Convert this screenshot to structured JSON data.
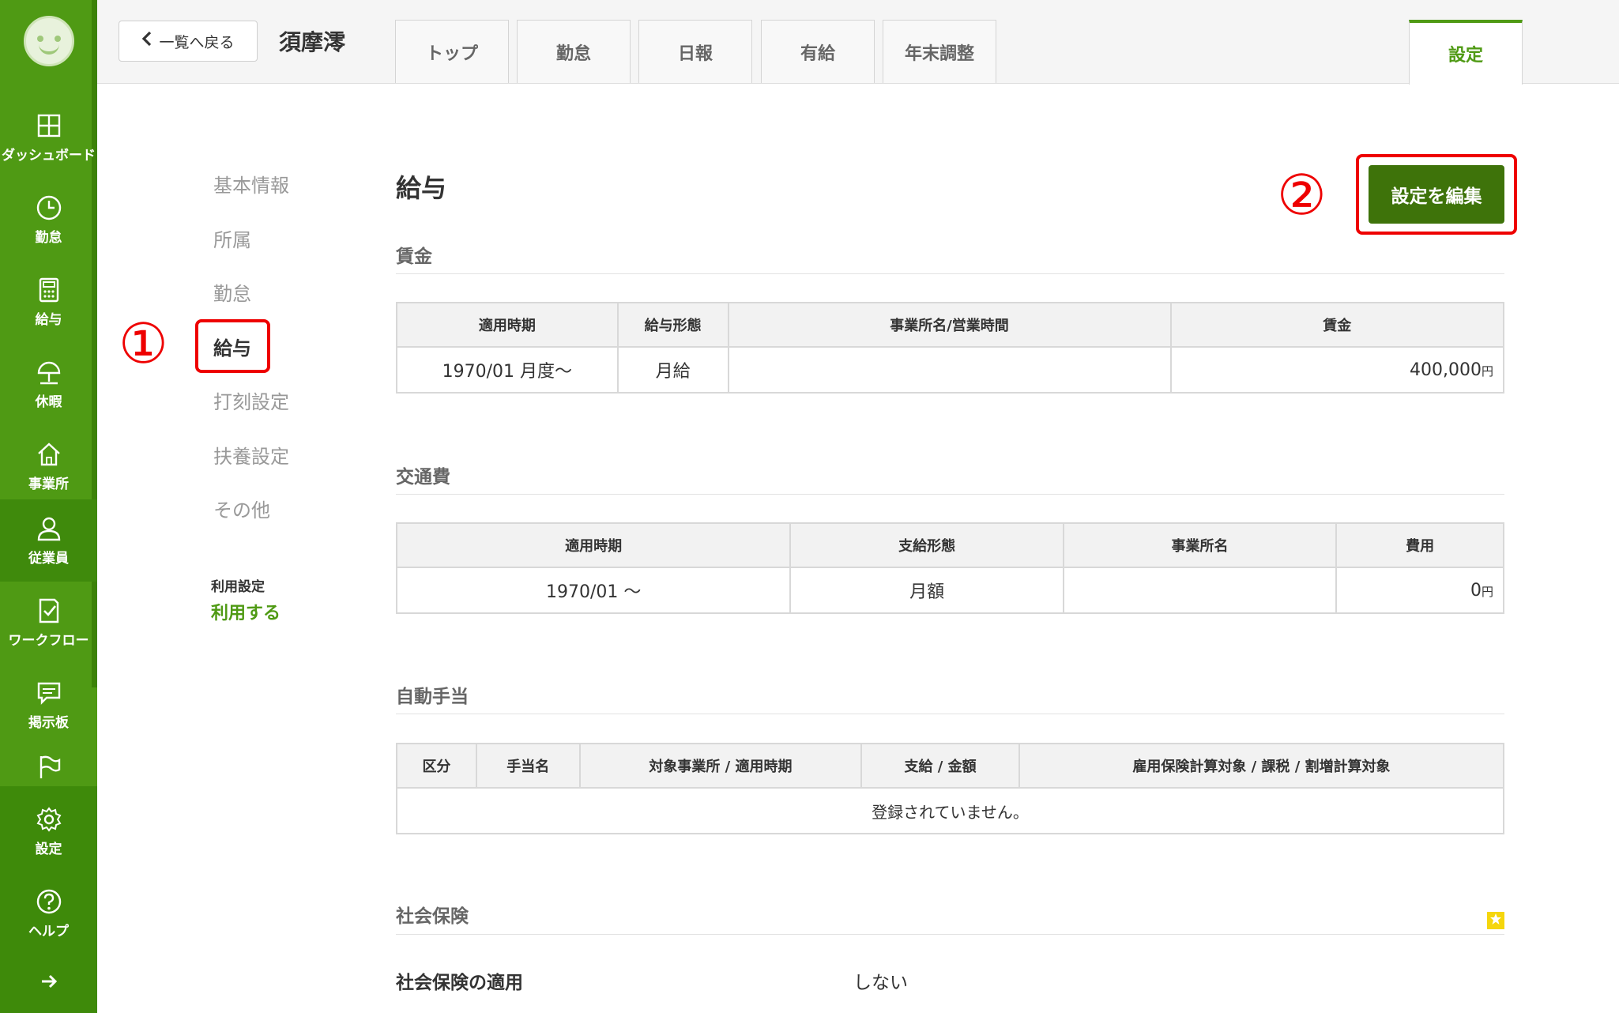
{
  "sidebar": {
    "items": [
      {
        "key": "dashboard",
        "label": "ダッシュボード",
        "icon": "dashboard-icon"
      },
      {
        "key": "attendance",
        "label": "勤怠",
        "icon": "clock-icon"
      },
      {
        "key": "payroll",
        "label": "給与",
        "icon": "calculator-icon"
      },
      {
        "key": "leave",
        "label": "休暇",
        "icon": "umbrella-icon"
      },
      {
        "key": "office",
        "label": "事業所",
        "icon": "home-icon"
      },
      {
        "key": "employees",
        "label": "従業員",
        "icon": "person-icon",
        "active": true
      },
      {
        "key": "workflow",
        "label": "ワークフロー",
        "icon": "checklist-icon"
      },
      {
        "key": "board",
        "label": "掲示板",
        "icon": "chat-icon"
      }
    ],
    "bottom": [
      {
        "key": "settings",
        "label": "設定",
        "icon": "gear-icon"
      },
      {
        "key": "help",
        "label": "ヘルプ",
        "icon": "help-icon"
      }
    ]
  },
  "header": {
    "back_label": "一覧へ戻る",
    "employee_name": "須摩澪",
    "tabs": [
      "トップ",
      "勤怠",
      "日報",
      "有給",
      "年末調整"
    ],
    "settings_tab": "設定"
  },
  "subnav": {
    "items": [
      "基本情報",
      "所属",
      "勤怠",
      "給与",
      "打刻設定",
      "扶養設定",
      "その他"
    ],
    "active_index": 3,
    "use_label": "利用設定",
    "use_value": "利用する"
  },
  "annotations": {
    "one": "①",
    "two": "②"
  },
  "main": {
    "title": "給与",
    "edit_button": "設定を編集",
    "wage": {
      "title": "賃金",
      "headers": [
        "適用時期",
        "給与形態",
        "事業所名/営業時間",
        "賃金"
      ],
      "row": {
        "period": "1970/01 月度〜",
        "type": "月給",
        "office": "",
        "amount": "400,000",
        "unit": "円"
      }
    },
    "transport": {
      "title": "交通費",
      "headers": [
        "適用時期",
        "支給形態",
        "事業所名",
        "費用"
      ],
      "row": {
        "period": "1970/01 〜",
        "type": "月額",
        "office": "",
        "amount": "0",
        "unit": "円"
      }
    },
    "allowance": {
      "title": "自動手当",
      "headers": [
        "区分",
        "手当名",
        "対象事業所 / 適用時期",
        "支給 / 金額",
        "雇用保険計算対象 / 課税 / 割増計算対象"
      ],
      "empty": "登録されていません。"
    },
    "insurance": {
      "title": "社会保険",
      "label": "社会保険の適用",
      "value": "しない"
    }
  },
  "colors": {
    "brand": "#4f9a14",
    "button": "#3e730a",
    "annotation": "#ee0000",
    "badge": "#f5d60c"
  }
}
